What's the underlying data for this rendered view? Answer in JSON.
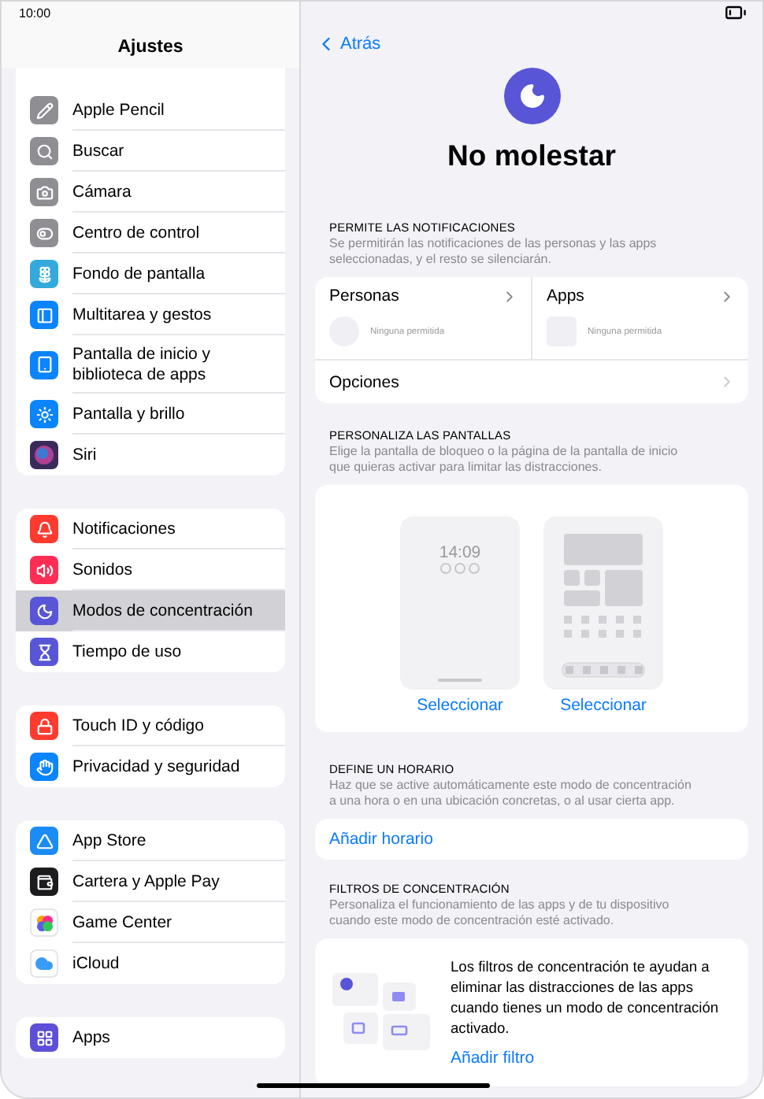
{
  "status_bar": {
    "time": "10:00"
  },
  "sidebar": {
    "title": "Ajustes",
    "groups": [
      {
        "items": [
          {
            "label": "Apple Pencil",
            "kind": "pencil",
            "color": "#8e8e93",
            "selected": false
          },
          {
            "label": "Buscar",
            "kind": "search",
            "color": "#8e8e93",
            "selected": false
          },
          {
            "label": "Cámara",
            "kind": "camera",
            "color": "#8e8e93",
            "selected": false
          },
          {
            "label": "Centro de control",
            "kind": "toggle",
            "color": "#8e8e93",
            "selected": false
          },
          {
            "label": "Fondo de pantalla",
            "kind": "flower",
            "color": "#34aadc",
            "selected": false
          },
          {
            "label": "Multitarea y gestos",
            "kind": "panel",
            "color": "#0a84ff",
            "selected": false
          },
          {
            "label": "Pantalla de inicio y biblioteca de apps",
            "kind": "tablet",
            "color": "#0a84ff",
            "selected": false
          },
          {
            "label": "Pantalla y brillo",
            "kind": "sun",
            "color": "#0a84ff",
            "selected": false
          },
          {
            "label": "Siri",
            "kind": "orb",
            "color": "#3a2a5a",
            "selected": false
          }
        ]
      },
      {
        "items": [
          {
            "label": "Notificaciones",
            "kind": "bell",
            "color": "#ff3b30",
            "selected": false
          },
          {
            "label": "Sonidos",
            "kind": "speaker",
            "color": "#ff2d55",
            "selected": false
          },
          {
            "label": "Modos de concentración",
            "kind": "moon",
            "color": "#5856d6",
            "selected": true
          },
          {
            "label": "Tiempo de uso",
            "kind": "hourglass",
            "color": "#5856d6",
            "selected": false
          }
        ]
      },
      {
        "items": [
          {
            "label": "Touch ID y código",
            "kind": "lock",
            "color": "#ff3b30",
            "selected": false
          },
          {
            "label": "Privacidad y seguridad",
            "kind": "hand",
            "color": "#0a84ff",
            "selected": false
          }
        ]
      },
      {
        "items": [
          {
            "label": "App Store",
            "kind": "triangle",
            "color": "#1c8cf5",
            "selected": false
          },
          {
            "label": "Cartera y Apple Pay",
            "kind": "wallet",
            "color": "#1c1c1e",
            "selected": false
          },
          {
            "label": "Game Center",
            "kind": "bubbles",
            "color": "#ffffff",
            "selected": false
          },
          {
            "label": "iCloud",
            "kind": "cloud",
            "color": "#ffffff",
            "selected": false
          }
        ]
      },
      {
        "items": [
          {
            "label": "Apps",
            "kind": "grid",
            "color": "#5e4fd8",
            "selected": false
          }
        ]
      }
    ]
  },
  "detail": {
    "back": "Atrás",
    "title": "No molestar",
    "sections": [
      {
        "kind": "allow",
        "header": "PERMITE LAS NOTIFICACIONES",
        "description": "Se permitirán las notificaciones de las personas y las apps seleccionadas, y el resto se silenciarán.",
        "columns": [
          {
            "label": "Personas",
            "kind": "circle",
            "note": "Ninguna permitida"
          },
          {
            "label": "Apps",
            "kind": "square",
            "note": "Ninguna permitida"
          }
        ],
        "row": "Opciones"
      },
      {
        "kind": "screens",
        "header": "PERSONALIZA LAS PANTALLAS",
        "description": "Elige la pantalla de bloqueo o la página de la pantalla de inicio que quieras activar para limitar las distracciones.",
        "screens": [
          {
            "kind": "lock",
            "time": "14:09",
            "action": "Seleccionar"
          },
          {
            "kind": "home",
            "action": "Seleccionar"
          }
        ]
      },
      {
        "kind": "schedule",
        "header": "DEFINE UN HORARIO",
        "description": "Haz que se active automáticamente este modo de concentración a una hora o en una ubicación concretas, o al usar cierta app.",
        "action": "Añadir horario"
      },
      {
        "kind": "filters",
        "header": "FILTROS DE CONCENTRACIÓN",
        "description": "Personaliza el funcionamiento de las apps y de tu dispositivo cuando este modo de concentración esté activado.",
        "text": "Los filtros de concentración te ayudan a eliminar las distracciones de las apps cuando tienes un modo de concentración activado.",
        "action": "Añadir filtro"
      }
    ]
  }
}
